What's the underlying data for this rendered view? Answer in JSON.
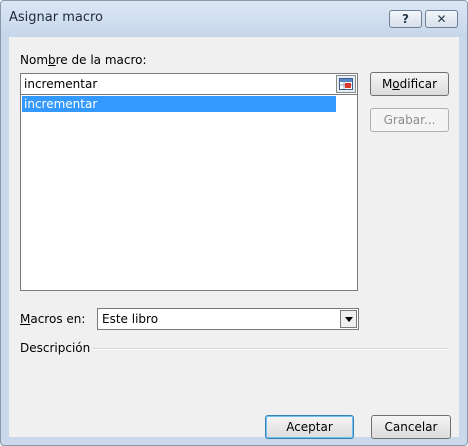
{
  "window": {
    "title": "Asignar macro",
    "help_glyph": "?",
    "close_glyph": "✕"
  },
  "macro_name": {
    "label_pre": "Nom",
    "label_mnemonic": "b",
    "label_post": "re de la macro:",
    "value": "incrementar"
  },
  "macro_list": {
    "items": [
      "incrementar"
    ],
    "selected": "incrementar"
  },
  "buttons": {
    "modify_pre": "M",
    "modify_mnemonic": "o",
    "modify_post": "dificar",
    "record": "Grabar...",
    "ok": "Aceptar",
    "cancel": "Cancelar"
  },
  "macros_in": {
    "label_mnemonic": "M",
    "label_post": "acros en:",
    "value": "Este libro"
  },
  "description": {
    "label": "Descripción"
  },
  "colors": {
    "selection": "#3399ff",
    "window_frame": "#c9d8ea",
    "client_bg": "#f0f0f0"
  },
  "icons": {
    "ref_button": "range-select-icon",
    "combo": "dropdown-arrow-icon"
  }
}
